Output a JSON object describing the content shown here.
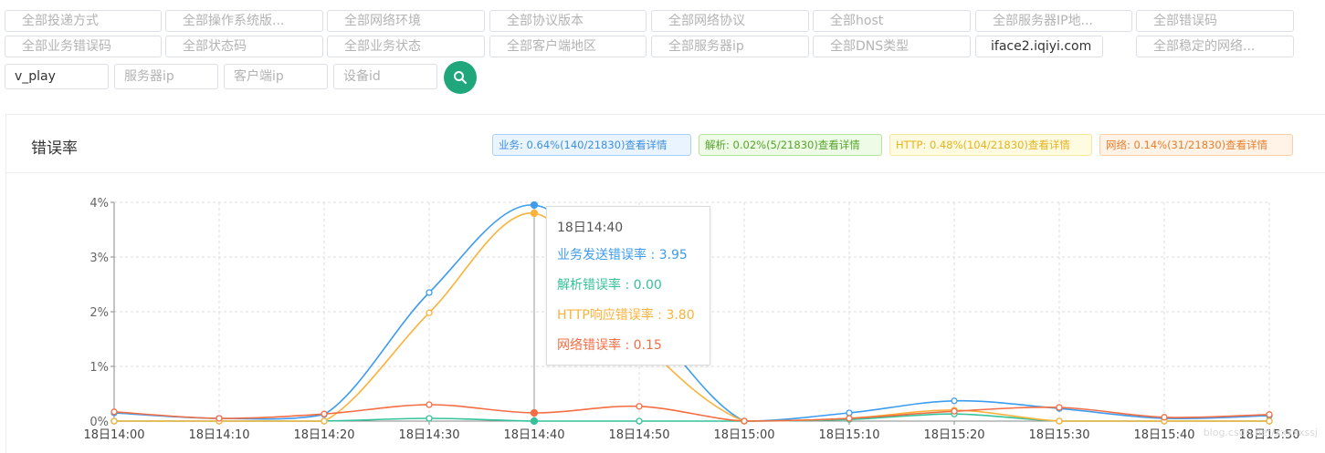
{
  "filters": {
    "row1": [
      "全部投递方式",
      "全部操作系统版...",
      "全部网络环境",
      "全部协议版本",
      "全部网络协议",
      "全部host",
      "全部服务器IP地...",
      "全部错误码"
    ],
    "row2": [
      "全部业务错误码",
      "全部状态码",
      "全部业务状态",
      "全部客户端地区",
      "全部服务器ip",
      "全部DNS类型",
      "iface2.iqiyi.com",
      "全部稳定的网络..."
    ],
    "inputs": [
      {
        "value": "v_play",
        "placeholder": ""
      },
      {
        "value": "",
        "placeholder": "服务器ip"
      },
      {
        "value": "",
        "placeholder": "客户端ip"
      },
      {
        "value": "",
        "placeholder": "设备id"
      }
    ]
  },
  "panel": {
    "title": "错误率",
    "badges": [
      "业务: 0.64%(140/21830)查看详情",
      "解析: 0.02%(5/21830)查看详情",
      "HTTP: 0.48%(104/21830)查看详情",
      "网络: 0.14%(31/21830)查看详情"
    ]
  },
  "tooltip": {
    "time": "18日14:40",
    "rows": [
      {
        "label": "业务发送错误率 : 3.95",
        "color": "#3d9cf0"
      },
      {
        "label": "解析错误率 : 0.00",
        "color": "#35c29b"
      },
      {
        "label": "HTTP响应错误率 : 3.80",
        "color": "#fab23a"
      },
      {
        "label": "网络错误率 : 0.15",
        "color": "#f46d43"
      }
    ]
  },
  "watermark": "blog.csdn.net/xxxxxssj",
  "chart_data": {
    "type": "line",
    "x": [
      "18日14:00",
      "18日14:10",
      "18日14:20",
      "18日14:30",
      "18日14:40",
      "18日14:50",
      "18日15:00",
      "18日15:10",
      "18日15:20",
      "18日15:30",
      "18日15:40",
      "18日15:50"
    ],
    "yticks": [
      "0%",
      "1%",
      "2%",
      "3%",
      "4%"
    ],
    "ylim": [
      0,
      4
    ],
    "grid": true,
    "series": [
      {
        "name": "业务发送错误率",
        "color": "#3d9cf0",
        "values": [
          0.15,
          0.05,
          0.12,
          2.35,
          3.95,
          2.0,
          0.0,
          0.15,
          0.37,
          0.23,
          0.05,
          0.1
        ]
      },
      {
        "name": "解析错误率",
        "color": "#35c29b",
        "values": [
          0.0,
          0.0,
          0.0,
          0.05,
          0.0,
          0.0,
          0.0,
          0.03,
          0.13,
          0.0,
          0.0,
          0.0
        ]
      },
      {
        "name": "HTTP响应错误率",
        "color": "#fab23a",
        "values": [
          0.0,
          0.0,
          0.0,
          1.98,
          3.8,
          1.5,
          0.0,
          0.05,
          0.2,
          0.0,
          0.0,
          0.0
        ]
      },
      {
        "name": "网络错误率",
        "color": "#f46d43",
        "values": [
          0.17,
          0.05,
          0.13,
          0.3,
          0.15,
          0.27,
          0.0,
          0.05,
          0.18,
          0.25,
          0.07,
          0.12
        ]
      }
    ]
  }
}
